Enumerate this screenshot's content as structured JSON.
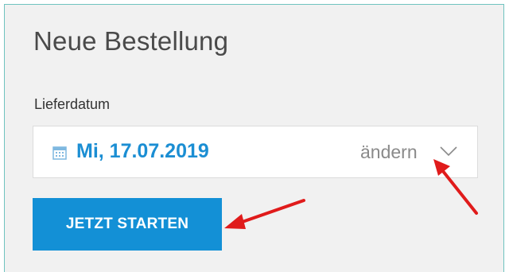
{
  "panel": {
    "title": "Neue Bestellung",
    "delivery_date_label": "Lieferdatum",
    "date_value": "Mi, 17.07.2019",
    "change_label": "ändern",
    "start_button_label": "JETZT STARTEN"
  },
  "icons": {
    "calendar": "calendar-icon",
    "dropdown": "chevron-down-icon",
    "annotation": "red-arrow"
  },
  "colors": {
    "accent": "#1390d6",
    "date_text": "#1b8ed3",
    "panel_background": "#f1f1f1",
    "panel_border": "#6fc3c0",
    "annotation_arrow": "#e01b1b"
  }
}
